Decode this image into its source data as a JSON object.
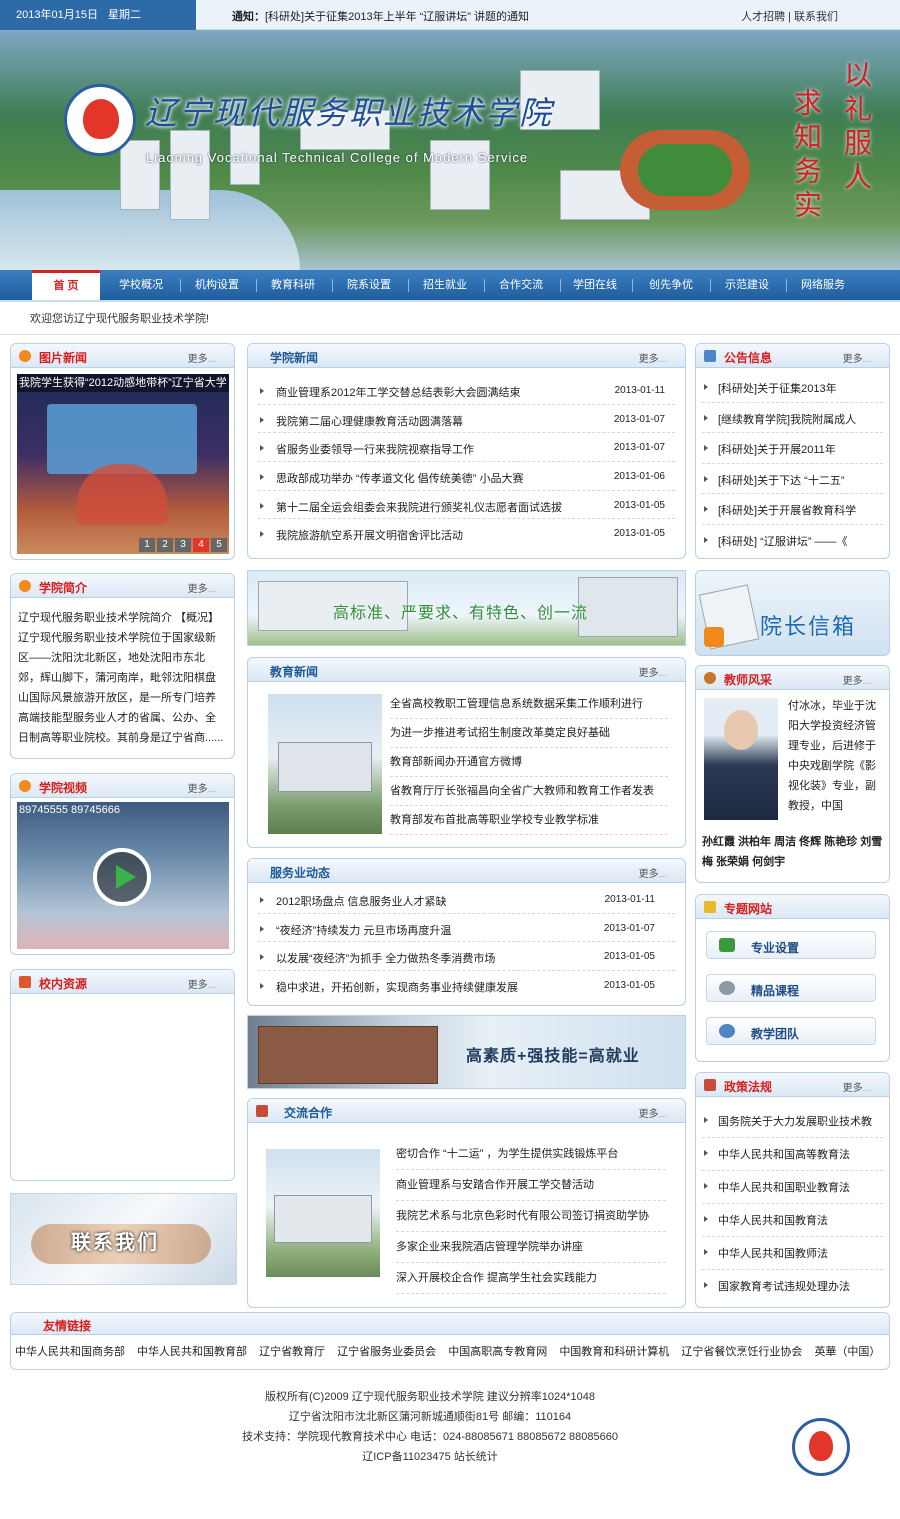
{
  "topbar": {
    "date": "2013年01月15日",
    "weekday": "星期二",
    "notice_label": "通知：",
    "notice_text": "[科研处]关于征集2013年上半年 “辽服讲坛” 讲题的通知",
    "jobs": "人才招聘",
    "sep": "|",
    "contact": "联系我们"
  },
  "banner": {
    "title": "辽宁现代服务职业技术学院",
    "subtitle": "Liaoning Vocational Technical College of Modern Service",
    "motto_right": "以礼服人",
    "motto_left": "求知务实"
  },
  "nav": [
    "首 页",
    "学校概况",
    "机构设置",
    "教育科研",
    "院系设置",
    "招生就业",
    "合作交流",
    "学团在线",
    "创先争优",
    "示范建设",
    "网络服务"
  ],
  "welcome": "欢迎您访辽宁现代服务职业技术学院!",
  "more": "更多",
  "photo_news": {
    "title": "图片新闻",
    "caption": "我院学生获得“2012动感地带杯”辽宁省大学",
    "pages": [
      "1",
      "2",
      "3",
      "4",
      "5"
    ]
  },
  "college_news": {
    "title": "学院新闻",
    "items": [
      {
        "t": "商业管理系2012年工学交替总结表彰大会圆满结束",
        "d": "2013-01-11"
      },
      {
        "t": "我院第二届心理健康教育活动圆满落幕",
        "d": "2013-01-07"
      },
      {
        "t": "省服务业委领导一行来我院视察指导工作",
        "d": "2013-01-07"
      },
      {
        "t": "思政部成功举办 “传孝道文化  倡传统美德” 小品大赛",
        "d": "2013-01-06"
      },
      {
        "t": "第十二届全运会组委会来我院进行颁奖礼仪志愿者面试选拔",
        "d": "2013-01-05"
      },
      {
        "t": "我院旅游航空系开展文明宿舍评比活动",
        "d": "2013-01-05"
      }
    ]
  },
  "notice": {
    "title": "公告信息",
    "items": [
      "[科研处]关于征集2013年",
      "[继续教育学院]我院附属成人",
      "[科研处]关于开展2011年",
      "[科研处]关于下达 “十二五”",
      "[科研处]关于开展省教育科学",
      "[科研处] “辽服讲坛” ——《"
    ]
  },
  "intro": {
    "title": "学院简介",
    "text": "辽宁现代服务职业技术学院简介 【概况】 辽宁现代服务职业技术学院位于国家级新区——沈阳沈北新区，地处沈阳市东北郊，辉山脚下，蒲河南岸，毗邻沈阳棋盘山国际风景旅游开放区，是一所专门培养高端技能型服务业人才的省属、公办、全日制高等职业院校。其前身是辽宁省商......"
  },
  "slogan_banner": "高标准、严要求、有特色、创一流",
  "mailbox": "院长信箱",
  "edu_news": {
    "title": "教育新闻",
    "items": [
      "全省高校教职工管理信息系统数据采集工作顺利进行",
      "为进一步推进考试招生制度改革奠定良好基础",
      "教育部新闻办开通官方微博",
      "省教育厅厅长张福昌向全省广大教师和教育工作者发表",
      "教育部发布首批高等职业学校专业教学标准"
    ]
  },
  "teacher": {
    "title": "教师风采",
    "text": "付冰冰，毕业于沈阳大学投资经济管理专业，后进修于中央戏剧学院《影视化装》专业，副教授，中国",
    "names": "孙红霞  洪柏年  周洁  佟辉  陈艳珍  刘雪梅  张荣娟  何剑宇"
  },
  "video": {
    "title": "学院视频",
    "phone": "89745555  89745666"
  },
  "service_news": {
    "title": "服务业动态",
    "items": [
      {
        "t": "2012职场盘点 信息服务业人才紧缺",
        "d": "2013-01-11"
      },
      {
        "t": "“夜经济”持续发力 元旦市场再度升温",
        "d": "2013-01-07"
      },
      {
        "t": "以发展“夜经济”为抓手 全力做热冬季消费市场",
        "d": "2013-01-05"
      },
      {
        "t": "稳中求进，开拓创新，实现商务事业持续健康发展",
        "d": "2013-01-05"
      }
    ]
  },
  "special": {
    "title": "专题网站",
    "items": [
      "专业设置",
      "精品课程",
      "教学团队"
    ]
  },
  "resources": {
    "title": "校内资源"
  },
  "job_banner": "高素质+强技能=高就业",
  "cooperation": {
    "title": "交流合作",
    "items": [
      "密切合作 “十二运” ，为学生提供实践锻炼平台",
      "商业管理系与安踏合作开展工学交替活动",
      "我院艺术系与北京色彩时代有限公司签订捐资助学协",
      "多家企业来我院酒店管理学院举办讲座",
      "深入开展校企合作  提高学生社会实践能力"
    ]
  },
  "policy": {
    "title": "政策法规",
    "items": [
      "国务院关于大力发展职业技术教",
      "中华人民共和国高等教育法",
      "中华人民共和国职业教育法",
      "中华人民共和国教育法",
      "中华人民共和国教师法",
      "国家教育考试违规处理办法"
    ]
  },
  "contact_banner": "联系我们",
  "friends": {
    "title": "友情链接",
    "items": [
      "中华人民共和国商务部",
      "中华人民共和国教育部",
      "辽宁省教育厅",
      "辽宁省服务业委员会",
      "中国高职高专教育网",
      "中国教育和科研计算机",
      "辽宁省餐饮烹饪行业协会",
      "英華（中国）"
    ]
  },
  "footer": [
    "版权所有(C)2009 辽宁现代服务职业技术学院  建议分辨率1024*1048",
    "辽宁省沈阳市沈北新区蒲河新城通顺街81号   邮编：110164",
    "技术支持：学院现代教育技术中心  电话：024-88085671 88085672 88085660",
    "辽ICP备11023475 站长统计"
  ],
  "colors": {
    "brand_blue": "#2d6aa8",
    "accent_red": "#d6201f",
    "panel_border": "#b9d0e6"
  }
}
